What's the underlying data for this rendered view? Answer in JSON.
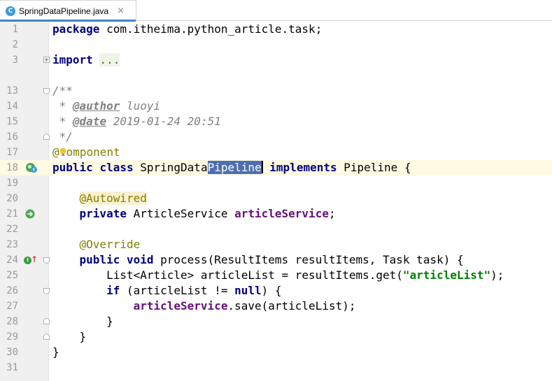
{
  "tab": {
    "title": "SpringDataPipeline.java",
    "icon": "java-class-icon",
    "icon_letter": "C",
    "close": "×"
  },
  "lines": [
    {
      "n": "1",
      "t": [
        "package",
        " com.itheima.python_article.task;"
      ]
    },
    {
      "n": "2",
      "t": []
    },
    {
      "n": "3",
      "t": [
        "import",
        " ",
        "..."
      ]
    },
    {
      "n": "13",
      "t": [
        "/**"
      ]
    },
    {
      "n": "14",
      "t": [
        " * ",
        "@author",
        " luoyi"
      ]
    },
    {
      "n": "15",
      "t": [
        " * ",
        "@date",
        " 2019-01-24 20:51"
      ]
    },
    {
      "n": "16",
      "t": [
        " */"
      ]
    },
    {
      "n": "17",
      "t": [
        "@",
        "omponent"
      ]
    },
    {
      "n": "18",
      "t": [
        "public",
        " ",
        "class",
        " SpringData",
        "Pipeline",
        " ",
        "implements",
        " Pipeline {"
      ]
    },
    {
      "n": "19",
      "t": []
    },
    {
      "n": "20",
      "t": [
        "    ",
        "@Autowired"
      ]
    },
    {
      "n": "21",
      "t": [
        "    ",
        "private",
        " ArticleService ",
        "articleService",
        ";"
      ]
    },
    {
      "n": "22",
      "t": []
    },
    {
      "n": "23",
      "t": [
        "    ",
        "@Override"
      ]
    },
    {
      "n": "24",
      "t": [
        "    ",
        "public",
        " ",
        "void",
        " process(ResultItems resultItems, Task task) {"
      ]
    },
    {
      "n": "25",
      "t": [
        "        List<Article> articleList = resultItems.get(",
        "\"articleList\"",
        ");"
      ]
    },
    {
      "n": "26",
      "t": [
        "        ",
        "if",
        " (articleList != ",
        "null",
        ") {"
      ]
    },
    {
      "n": "27",
      "t": [
        "            ",
        "articleService",
        ".save(articleList);"
      ]
    },
    {
      "n": "28",
      "t": [
        "        }"
      ]
    },
    {
      "n": "29",
      "t": [
        "    }"
      ]
    },
    {
      "n": "30",
      "t": [
        "}"
      ]
    },
    {
      "n": "31",
      "t": []
    }
  ],
  "gutter_icons": {
    "line18": "spring-bean-class-icon",
    "line21": "spring-autowired-navigate-icon",
    "line24": "implements-method-icon",
    "line17": "intention-bulb-icon"
  },
  "colors": {
    "keyword": "#000080",
    "annotation": "#808000",
    "comment": "#808080",
    "field": "#660e7a",
    "string": "#008000",
    "selection": "#4d6fb0",
    "current_line": "#fffae3"
  },
  "gutter_letters": {
    "class": "c",
    "implements": "I",
    "up_arrow": "↑"
  }
}
